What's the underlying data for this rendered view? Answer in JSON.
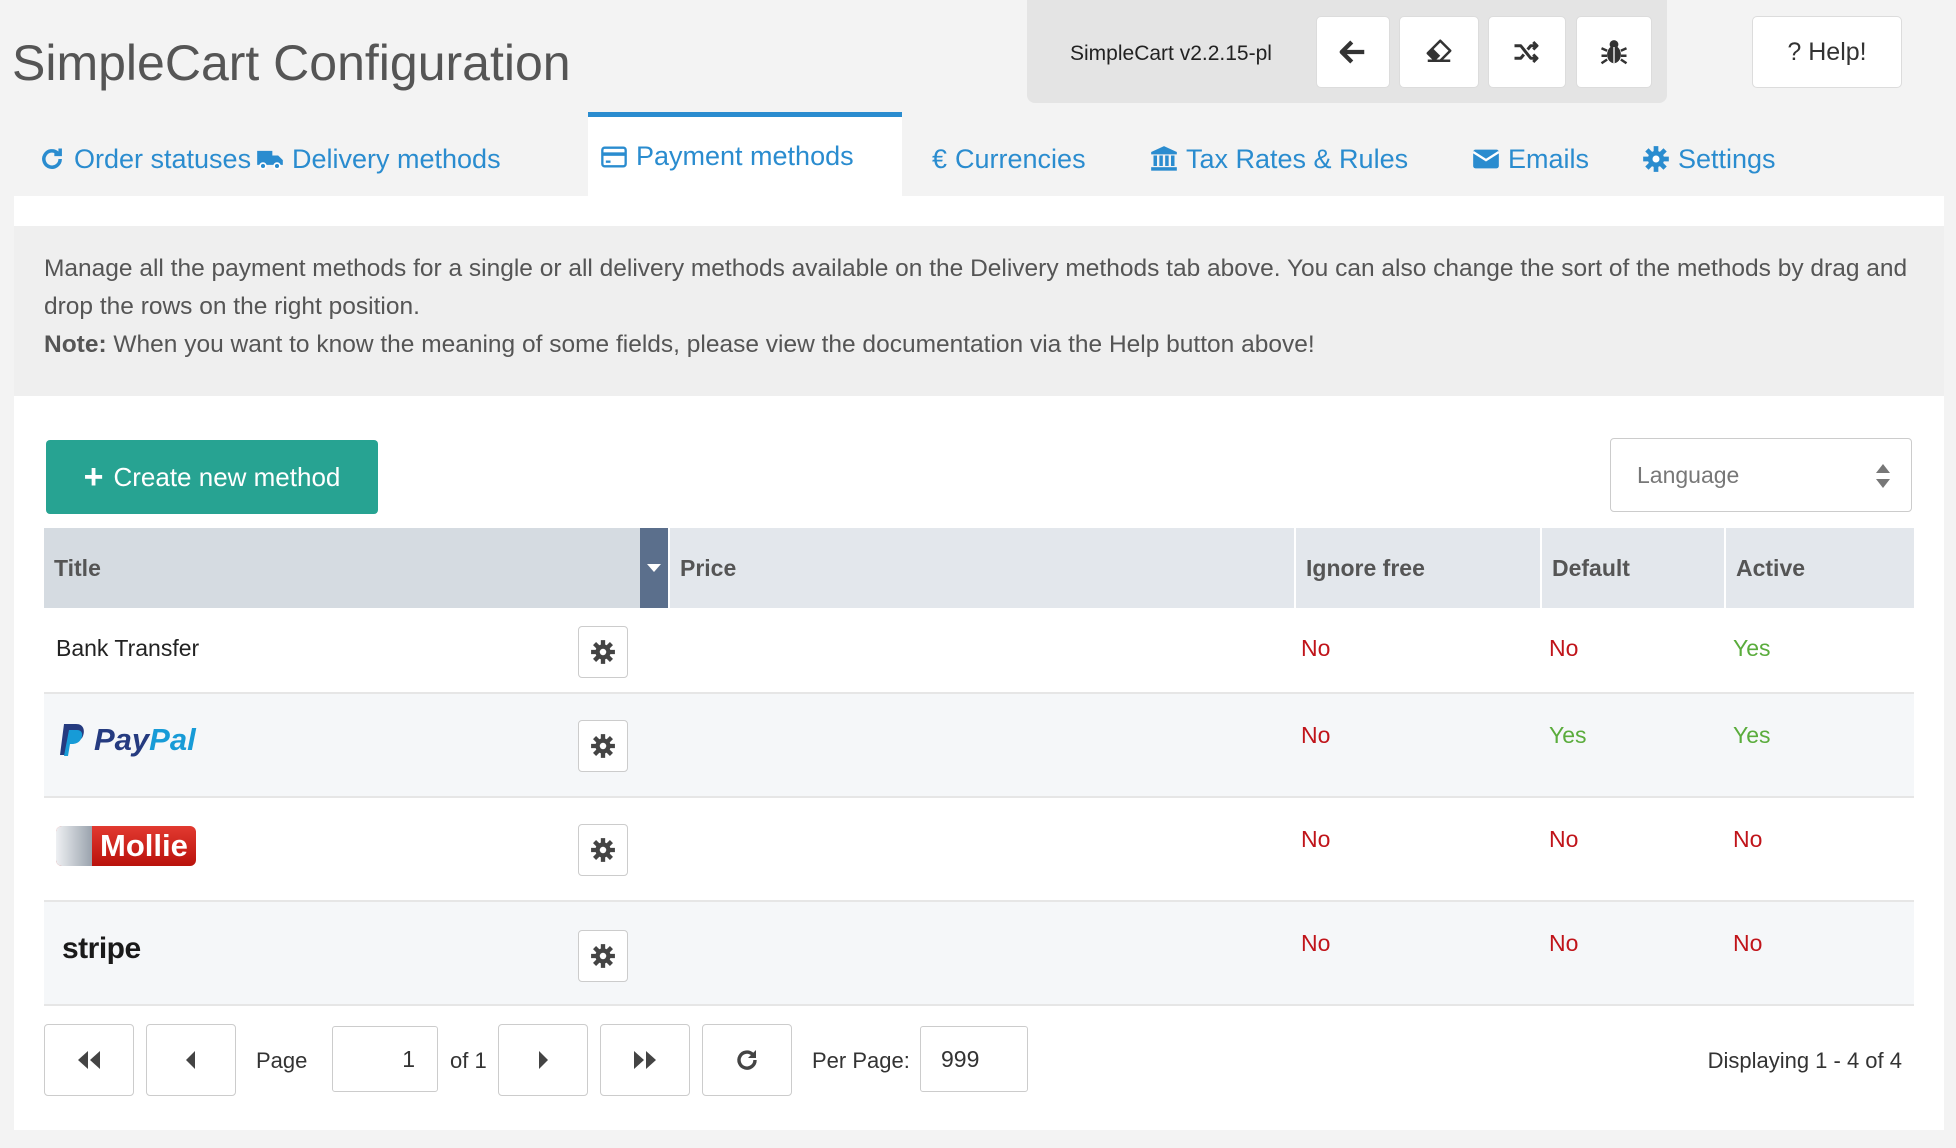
{
  "header": {
    "title": "SimpleCart Configuration",
    "version": "SimpleCart v2.2.15-pl",
    "buttons": {
      "back_icon": "arrow-left-icon",
      "eraser_icon": "eraser-icon",
      "random_icon": "shuffle-icon",
      "bug_icon": "bug-icon",
      "help_label": "? Help!"
    }
  },
  "tabs": [
    {
      "label": "Order statuses",
      "icon": "refresh-icon"
    },
    {
      "label": "Delivery methods",
      "icon": "truck-icon"
    },
    {
      "label": "Payment methods",
      "icon": "credit-card-icon",
      "active": true
    },
    {
      "label": "Currencies",
      "icon": "euro-icon"
    },
    {
      "label": "Tax Rates & Rules",
      "icon": "bank-icon"
    },
    {
      "label": "Emails",
      "icon": "envelope-icon"
    },
    {
      "label": "Settings",
      "icon": "gear-icon"
    }
  ],
  "info": {
    "text": "Manage all the payment methods for a single or all delivery methods available on the Delivery methods tab above. You can also change the sort of the methods by drag and drop the rows on the right position.",
    "note_label": "Note:",
    "note_text": " When you want to know the meaning of some fields, please view the documentation via the Help button above!"
  },
  "actions": {
    "create_label": "Create new method",
    "language_placeholder": "Language"
  },
  "grid": {
    "columns": [
      "Title",
      "Price",
      "Ignore free",
      "Default",
      "Active"
    ],
    "rows": [
      {
        "title": "Bank Transfer",
        "logo": "",
        "price": "",
        "ignore_free": "No",
        "default": "No",
        "active": "Yes"
      },
      {
        "title": "PayPal",
        "logo": "paypal",
        "price": "",
        "ignore_free": "No",
        "default": "Yes",
        "active": "Yes"
      },
      {
        "title": "Mollie",
        "logo": "mollie",
        "price": "",
        "ignore_free": "No",
        "default": "No",
        "active": "No"
      },
      {
        "title": "stripe",
        "logo": "stripe",
        "price": "",
        "ignore_free": "No",
        "default": "No",
        "active": "No"
      }
    ]
  },
  "pager": {
    "page_label": "Page",
    "page_value": "1",
    "of_label": "of 1",
    "per_page_label": "Per Page:",
    "per_page_value": "999",
    "display_text": "Displaying 1 - 4 of 4"
  },
  "colors": {
    "accent": "#2a8ccf",
    "create_button": "#27a392",
    "no": "#c0141a",
    "yes": "#5aac3c"
  }
}
